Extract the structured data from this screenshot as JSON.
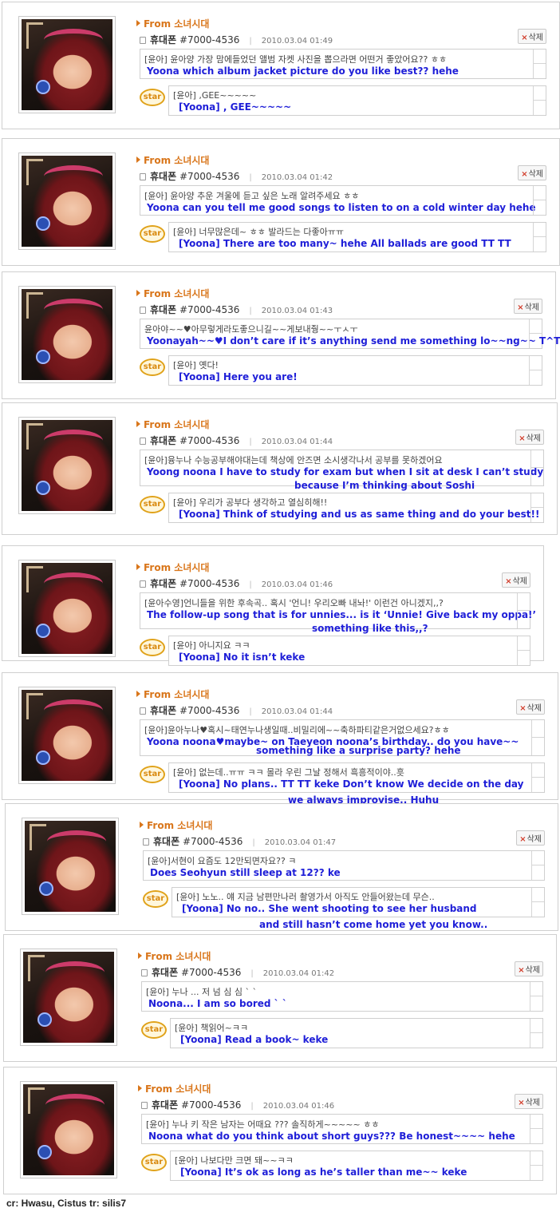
{
  "cards": [
    {
      "from": "From 소녀시대",
      "sender": "휴대폰",
      "number": "#7000-4536",
      "date": "2010.03.04 01:49",
      "delete": "삭제",
      "msg_kr": "[윤아] 윤아양 가장 맘에들었던 앨범 자켓 사진을 뽑으라면 어떤거 좋았어요?? ㅎㅎ",
      "msg_en": "Yoona which album jacket picture do you like best?? hehe",
      "msg_en2": "",
      "star": "star",
      "reply_kr": "[윤아] ,GEE~~~~~",
      "reply_en": "[Yoona] , GEE~~~~~",
      "reply_en2": ""
    },
    {
      "from": "From 소녀시대",
      "sender": "휴대폰",
      "number": "#7000-4536",
      "date": "2010.03.04 01:42",
      "delete": "삭제",
      "msg_kr": "[윤아] 윤아양 추운 겨울에 듣고 싶은 노래 알려주세요 ㅎㅎ",
      "msg_en": "Yoona can you tell me good songs to listen to on a cold winter day hehe",
      "msg_en2": "",
      "star": "star",
      "reply_kr": "[윤아] 너무많은데~ ㅎㅎ 발라드는 다좋아ㅠㅠ",
      "reply_en": "[Yoona] There are too many~ hehe All ballads are good TT TT",
      "reply_en2": ""
    },
    {
      "from": "From 소녀시대",
      "sender": "휴대폰",
      "number": "#7000-4536",
      "date": "2010.03.04 01:43",
      "delete": "삭제",
      "msg_kr": "윤아야~~♥아무렇게라도좋으니길~~게보내줭~~ㅜㅅㅜ",
      "msg_en": "Yoonayah~~♥I don’t care if it’s anything send me something lo~~ng~~ T^T",
      "msg_en2": "",
      "star": "star",
      "reply_kr": "[윤아] 옛다!",
      "reply_en": "[Yoona] Here you are!",
      "reply_en2": ""
    },
    {
      "from": "From 소녀시대",
      "sender": "휴대폰",
      "number": "#7000-4536",
      "date": "2010.03.04 01:44",
      "delete": "삭제",
      "msg_kr": "[윤아]융누나 수능공부해야대는데 책상에 안즈면 소시생각나서 공부를 못하겠어요",
      "msg_en": "Yoong noona I have to study for exam but when I sit at desk I can’t study",
      "msg_en2": "because I’m thinking about Soshi",
      "star": "star",
      "reply_kr": "[윤아] 우리가 공부다 생각하고 열심히해!!",
      "reply_en": "[Yoona] Think of studying and us as same thing and do your best!!",
      "reply_en2": ""
    },
    {
      "from": "From 소녀시대",
      "sender": "휴대폰",
      "number": "#7000-4536",
      "date": "2010.03.04 01:46",
      "delete": "삭제",
      "msg_kr": "[윤아수영]언니들을 위한 후속곡.. 혹시 '언니! 우리오빠 내놔!' 이런건 아니겠지,,?",
      "msg_en": "The follow-up song that is for unnies... is it ‘Unnie! Give back my oppa!’",
      "msg_en2": "something like this,,?",
      "star": "star",
      "reply_kr": "[윤아] 아니지요 ㅋㅋ",
      "reply_en": "[Yoona] No it isn’t keke",
      "reply_en2": ""
    },
    {
      "from": "From 소녀시대",
      "sender": "휴대폰",
      "number": "#7000-4536",
      "date": "2010.03.04 01:44",
      "delete": "삭제",
      "msg_kr": "[윤아]윤아누나♥혹시~태연누나생일때..비밀리에~~축하파티같은거없으세요?ㅎㅎ",
      "msg_en": "Yoona noona♥maybe~ on Taeyeon noona’s birthday.. do you have~~",
      "msg_en2": "something like a surprise party? hehe",
      "star": "star",
      "reply_kr": "[윤아] 없는데..ㅠㅠ ㅋㅋ 몰라 우린 그날 정해서 흑흥적이야..흣",
      "reply_en": "[Yoona] No plans.. TT TT keke Don’t know We decide on the day",
      "reply_en2": "we always improvise.. Huhu"
    },
    {
      "from": "From 소녀시대",
      "sender": "휴대폰",
      "number": "#7000-4536",
      "date": "2010.03.04 01:47",
      "delete": "삭제",
      "msg_kr": "[윤아]서현이 요즘도 12만되면자요?? ㅋ",
      "msg_en": "Does Seohyun still sleep at 12?? ke",
      "msg_en2": "",
      "star": "star",
      "reply_kr": "[윤아] 노노.. 얘 지금 남편만나러 촬영가서 아직도 안들어왔는데 무슨..",
      "reply_en": "[Yoona] No no.. She went shooting to see her husband",
      "reply_en2": "and still hasn’t come home yet you know.."
    },
    {
      "from": "From 소녀시대",
      "sender": "휴대폰",
      "number": "#7000-4536",
      "date": "2010.03.04 01:42",
      "delete": "삭제",
      "msg_kr": "[윤아] 누나 ... 저 넘 심 심 ` `",
      "msg_en": "Noona... I am so bored ` `",
      "msg_en2": "",
      "star": "star",
      "reply_kr": "[윤아] 책읽어~ㅋㅋ",
      "reply_en": "[Yoona] Read a book~ keke",
      "reply_en2": ""
    },
    {
      "from": "From 소녀시대",
      "sender": "휴대폰",
      "number": "#7000-4536",
      "date": "2010.03.04 01:46",
      "delete": "삭제",
      "msg_kr": "[윤아] 누나 키 작은 남자는 어때요 ??? 솔직하게~~~~~ ㅎㅎ",
      "msg_en": "Noona what do you think about short guys??? Be honest~~~~ hehe",
      "msg_en2": "",
      "star": "star",
      "reply_kr": "[윤아] 나보다만 크면 돼~~ㅋㅋ",
      "reply_en": "[Yoona] It’s ok as long as he’s taller than me~~ keke",
      "reply_en2": ""
    }
  ],
  "credit": "cr: Hwasu, Cistus  tr: silis7"
}
